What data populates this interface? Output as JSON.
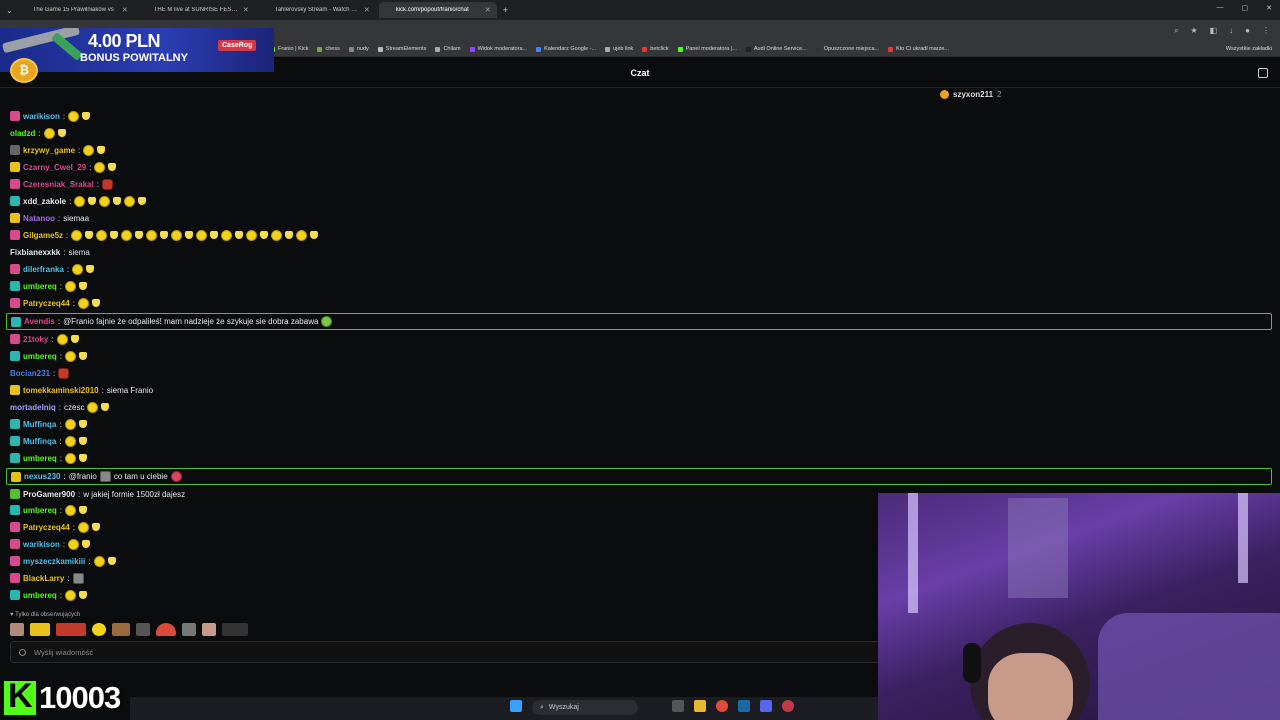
{
  "browser": {
    "tabs": [
      {
        "label": "The Game 15 Prawilniaków vs",
        "color": "#e53935",
        "active": false
      },
      {
        "label": "THE M live at SUNRISE FESTIVAL",
        "color": "#e53935",
        "active": false
      },
      {
        "label": "Tahlerovsky Stream - Watch Live",
        "color": "#53fc18",
        "active": false
      },
      {
        "label": "kick.com/popout/franio/chat",
        "color": "#53fc18",
        "active": true
      }
    ],
    "new_tab": "+",
    "bookmarks": [
      {
        "label": "Franio | Kick",
        "color": "#53fc18"
      },
      {
        "label": "chess",
        "color": "#7aa34e"
      },
      {
        "label": "nudy",
        "color": "#888888"
      },
      {
        "label": "StreamElements",
        "color": "#bbbbbb"
      },
      {
        "label": "Chilam",
        "color": "#aaaaaa"
      },
      {
        "label": "Widok moderatora...",
        "color": "#9146ff"
      },
      {
        "label": "Kalendarz Google -...",
        "color": "#4285f4"
      },
      {
        "label": "ujeb link",
        "color": "#aaaaaa"
      },
      {
        "label": "betclick",
        "color": "#e53935"
      },
      {
        "label": "Panel moderatora |...",
        "color": "#53fc18"
      },
      {
        "label": "Audi Online Service...",
        "color": "#222222"
      },
      {
        "label": "Opuszczone miejsca...",
        "color": "#333333"
      },
      {
        "label": "Kto Ci ukradł marze...",
        "color": "#e53935"
      }
    ],
    "bookmarks_all": "Wszystkie zakładki"
  },
  "ad": {
    "amount": "4.00 PLN",
    "bonus": "BONUS POWITALNY",
    "brand": "CaseRog"
  },
  "chat": {
    "title": "Czat",
    "pinned_user": "szyxon211",
    "pinned_count": "2",
    "messages": [
      {
        "user": "warikison",
        "color": "#53c0e8",
        "badge": "pink",
        "text": "",
        "emotes": [
          "emote",
          "wave"
        ]
      },
      {
        "user": "oladzd",
        "color": "#53fc18",
        "badge": "",
        "text": "",
        "emotes": [
          "emote",
          "wave"
        ]
      },
      {
        "user": "krzywy_game",
        "color": "#e8c21a",
        "badge": "grey",
        "text": "",
        "emotes": [
          "emote",
          "wave"
        ]
      },
      {
        "user": "Czarny_Cwel_29",
        "color": "#d94a8c",
        "badge": "yellow",
        "text": "",
        "emotes": [
          "emote",
          "wave"
        ]
      },
      {
        "user": "Czeresniak_Srakal",
        "color": "#d94a8c",
        "badge": "pink",
        "text": "",
        "emotes": [
          "red"
        ]
      },
      {
        "user": "xdd_zakole",
        "color": "#e8e8e8",
        "badge": "teal",
        "text": "",
        "emotes": [
          "emote",
          "wave",
          "emote",
          "wave",
          "emote",
          "wave"
        ]
      },
      {
        "user": "Natanoo",
        "color": "#a06be8",
        "badge": "yellow",
        "text": "siemaa",
        "emotes": []
      },
      {
        "user": "Gilgame5z",
        "color": "#e8c21a",
        "badge": "pink",
        "text": "",
        "emotes": [
          "emote",
          "wave",
          "emote",
          "wave",
          "emote",
          "wave",
          "emote",
          "wave",
          "emote",
          "wave",
          "emote",
          "wave",
          "emote",
          "wave",
          "emote",
          "wave",
          "emote",
          "wave",
          "emote",
          "wave"
        ]
      },
      {
        "user": "Fixbianexxkk",
        "color": "#e8e8e8",
        "badge": "",
        "text": "siema",
        "emotes": []
      },
      {
        "user": "dilerfranka",
        "color": "#53c0e8",
        "badge": "pink",
        "text": "",
        "emotes": [
          "emote",
          "wave"
        ]
      },
      {
        "user": "umbereq",
        "color": "#53fc18",
        "badge": "teal",
        "text": "",
        "emotes": [
          "emote",
          "wave"
        ]
      },
      {
        "user": "Patryczeq44",
        "color": "#e8c21a",
        "badge": "pink",
        "text": "",
        "emotes": [
          "emote",
          "wave"
        ]
      },
      {
        "user": "Avendis",
        "color": "#d94a8c",
        "badge": "teal",
        "text": "@Franio fajnie że odpaliłeś! mam nadzieje że szykuje sie dobra zabawa",
        "emotes": [
          "hand"
        ],
        "highlight": true
      },
      {
        "user": "21toky",
        "color": "#d94a8c",
        "badge": "pink",
        "text": "",
        "emotes": [
          "emote",
          "wave"
        ]
      },
      {
        "user": "umbereq",
        "color": "#53fc18",
        "badge": "teal",
        "text": "",
        "emotes": [
          "emote",
          "wave"
        ]
      },
      {
        "user": "Bocian231",
        "color": "#4a7ae8",
        "badge": "",
        "text": "",
        "emotes": [
          "red"
        ]
      },
      {
        "user": "tomekkaminski2010",
        "color": "#e8c21a",
        "badge": "yellow",
        "text": "siema Franio",
        "emotes": []
      },
      {
        "user": "mortadelniq",
        "color": "#a0a0ff",
        "badge": "",
        "text": "czesc",
        "emotes": [
          "emote",
          "wave"
        ]
      },
      {
        "user": "Muffinqa",
        "color": "#53c0e8",
        "badge": "teal",
        "text": "",
        "emotes": [
          "emote",
          "wave"
        ]
      },
      {
        "user": "Muffinqa",
        "color": "#53c0e8",
        "badge": "teal",
        "text": "",
        "emotes": [
          "emote",
          "wave"
        ]
      },
      {
        "user": "umbereq",
        "color": "#53fc18",
        "badge": "teal",
        "text": "",
        "emotes": [
          "emote",
          "wave"
        ]
      },
      {
        "user": "nexus230",
        "color": "#53c0e8",
        "badge": "yellow",
        "text": "@franio",
        "text2": "co tam u ciebie",
        "emotes": [
          "blob"
        ],
        "highlight": true
      },
      {
        "user": "ProGamer900",
        "color": "#e8e8e8",
        "badge": "green",
        "text": "w jakiej formie 1500zł dajesz",
        "emotes": []
      },
      {
        "user": "umbereq",
        "color": "#53fc18",
        "badge": "teal",
        "text": "",
        "emotes": [
          "emote",
          "wave"
        ]
      },
      {
        "user": "Patryczeq44",
        "color": "#e8c21a",
        "badge": "pink",
        "text": "",
        "emotes": [
          "emote",
          "wave"
        ]
      },
      {
        "user": "warikison",
        "color": "#53c0e8",
        "badge": "pink",
        "text": "",
        "emotes": [
          "emote",
          "wave"
        ]
      },
      {
        "user": "myszeczkamikiii",
        "color": "#53c0e8",
        "badge": "pink",
        "text": "",
        "emotes": [
          "emote",
          "wave"
        ]
      },
      {
        "user": "BlackLarry",
        "color": "#e8c21a",
        "badge": "pink",
        "text": "",
        "emotes": [
          "mask"
        ]
      },
      {
        "user": "umbereq",
        "color": "#53fc18",
        "badge": "teal",
        "text": "",
        "emotes": [
          "emote",
          "wave"
        ]
      }
    ],
    "followers_only": "♥ Tylko dla obserwujących",
    "input_placeholder": "Wyślij wiadomość"
  },
  "overlay": {
    "follower_count": "10003"
  },
  "taskbar": {
    "search_label": "Wyszukaj"
  }
}
